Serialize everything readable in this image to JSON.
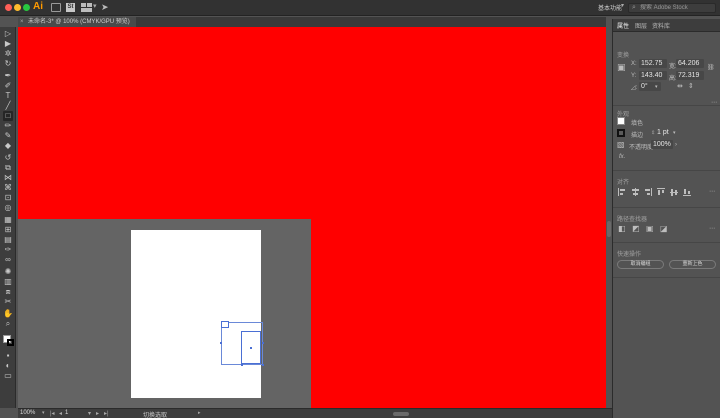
{
  "app": {
    "logo": "Ai",
    "workspace": "基本功能",
    "stock_search_placeholder": "搜索 Adobe Stock"
  },
  "document": {
    "tab_title": "未命名-3* @ 100% (CMYK/GPU 预览)"
  },
  "panel": {
    "tabs": [
      "属性",
      "图层",
      "资料库"
    ],
    "transform": {
      "title": "变换",
      "x_label": "X:",
      "x_value": "152.75",
      "w_label": "宽:",
      "w_value": "64.206",
      "y_label": "Y:",
      "y_value": "143.40",
      "h_label": "高:",
      "h_value": "72.319",
      "rotate_label": "◿:",
      "rotate_value": "0°"
    },
    "appearance": {
      "title": "外观",
      "fill_label": "填色",
      "stroke_label": "描边",
      "stroke_weight": "1 pt",
      "opacity_label": "不透明度",
      "opacity_value": "100%",
      "fx_label": "fx."
    },
    "align": {
      "title": "对齐"
    },
    "pathfinder": {
      "title": "路径查找器"
    },
    "quick_actions": {
      "title": "快速操作",
      "button1": "取消编组",
      "button2": "重新上色"
    }
  },
  "status": {
    "zoom": "100%",
    "page": "1",
    "tool_name": "切换选取"
  },
  "colors": {
    "canvas_fill": "#ff0000",
    "artboard": "#ffffff",
    "selection": "#4a6fd4"
  }
}
